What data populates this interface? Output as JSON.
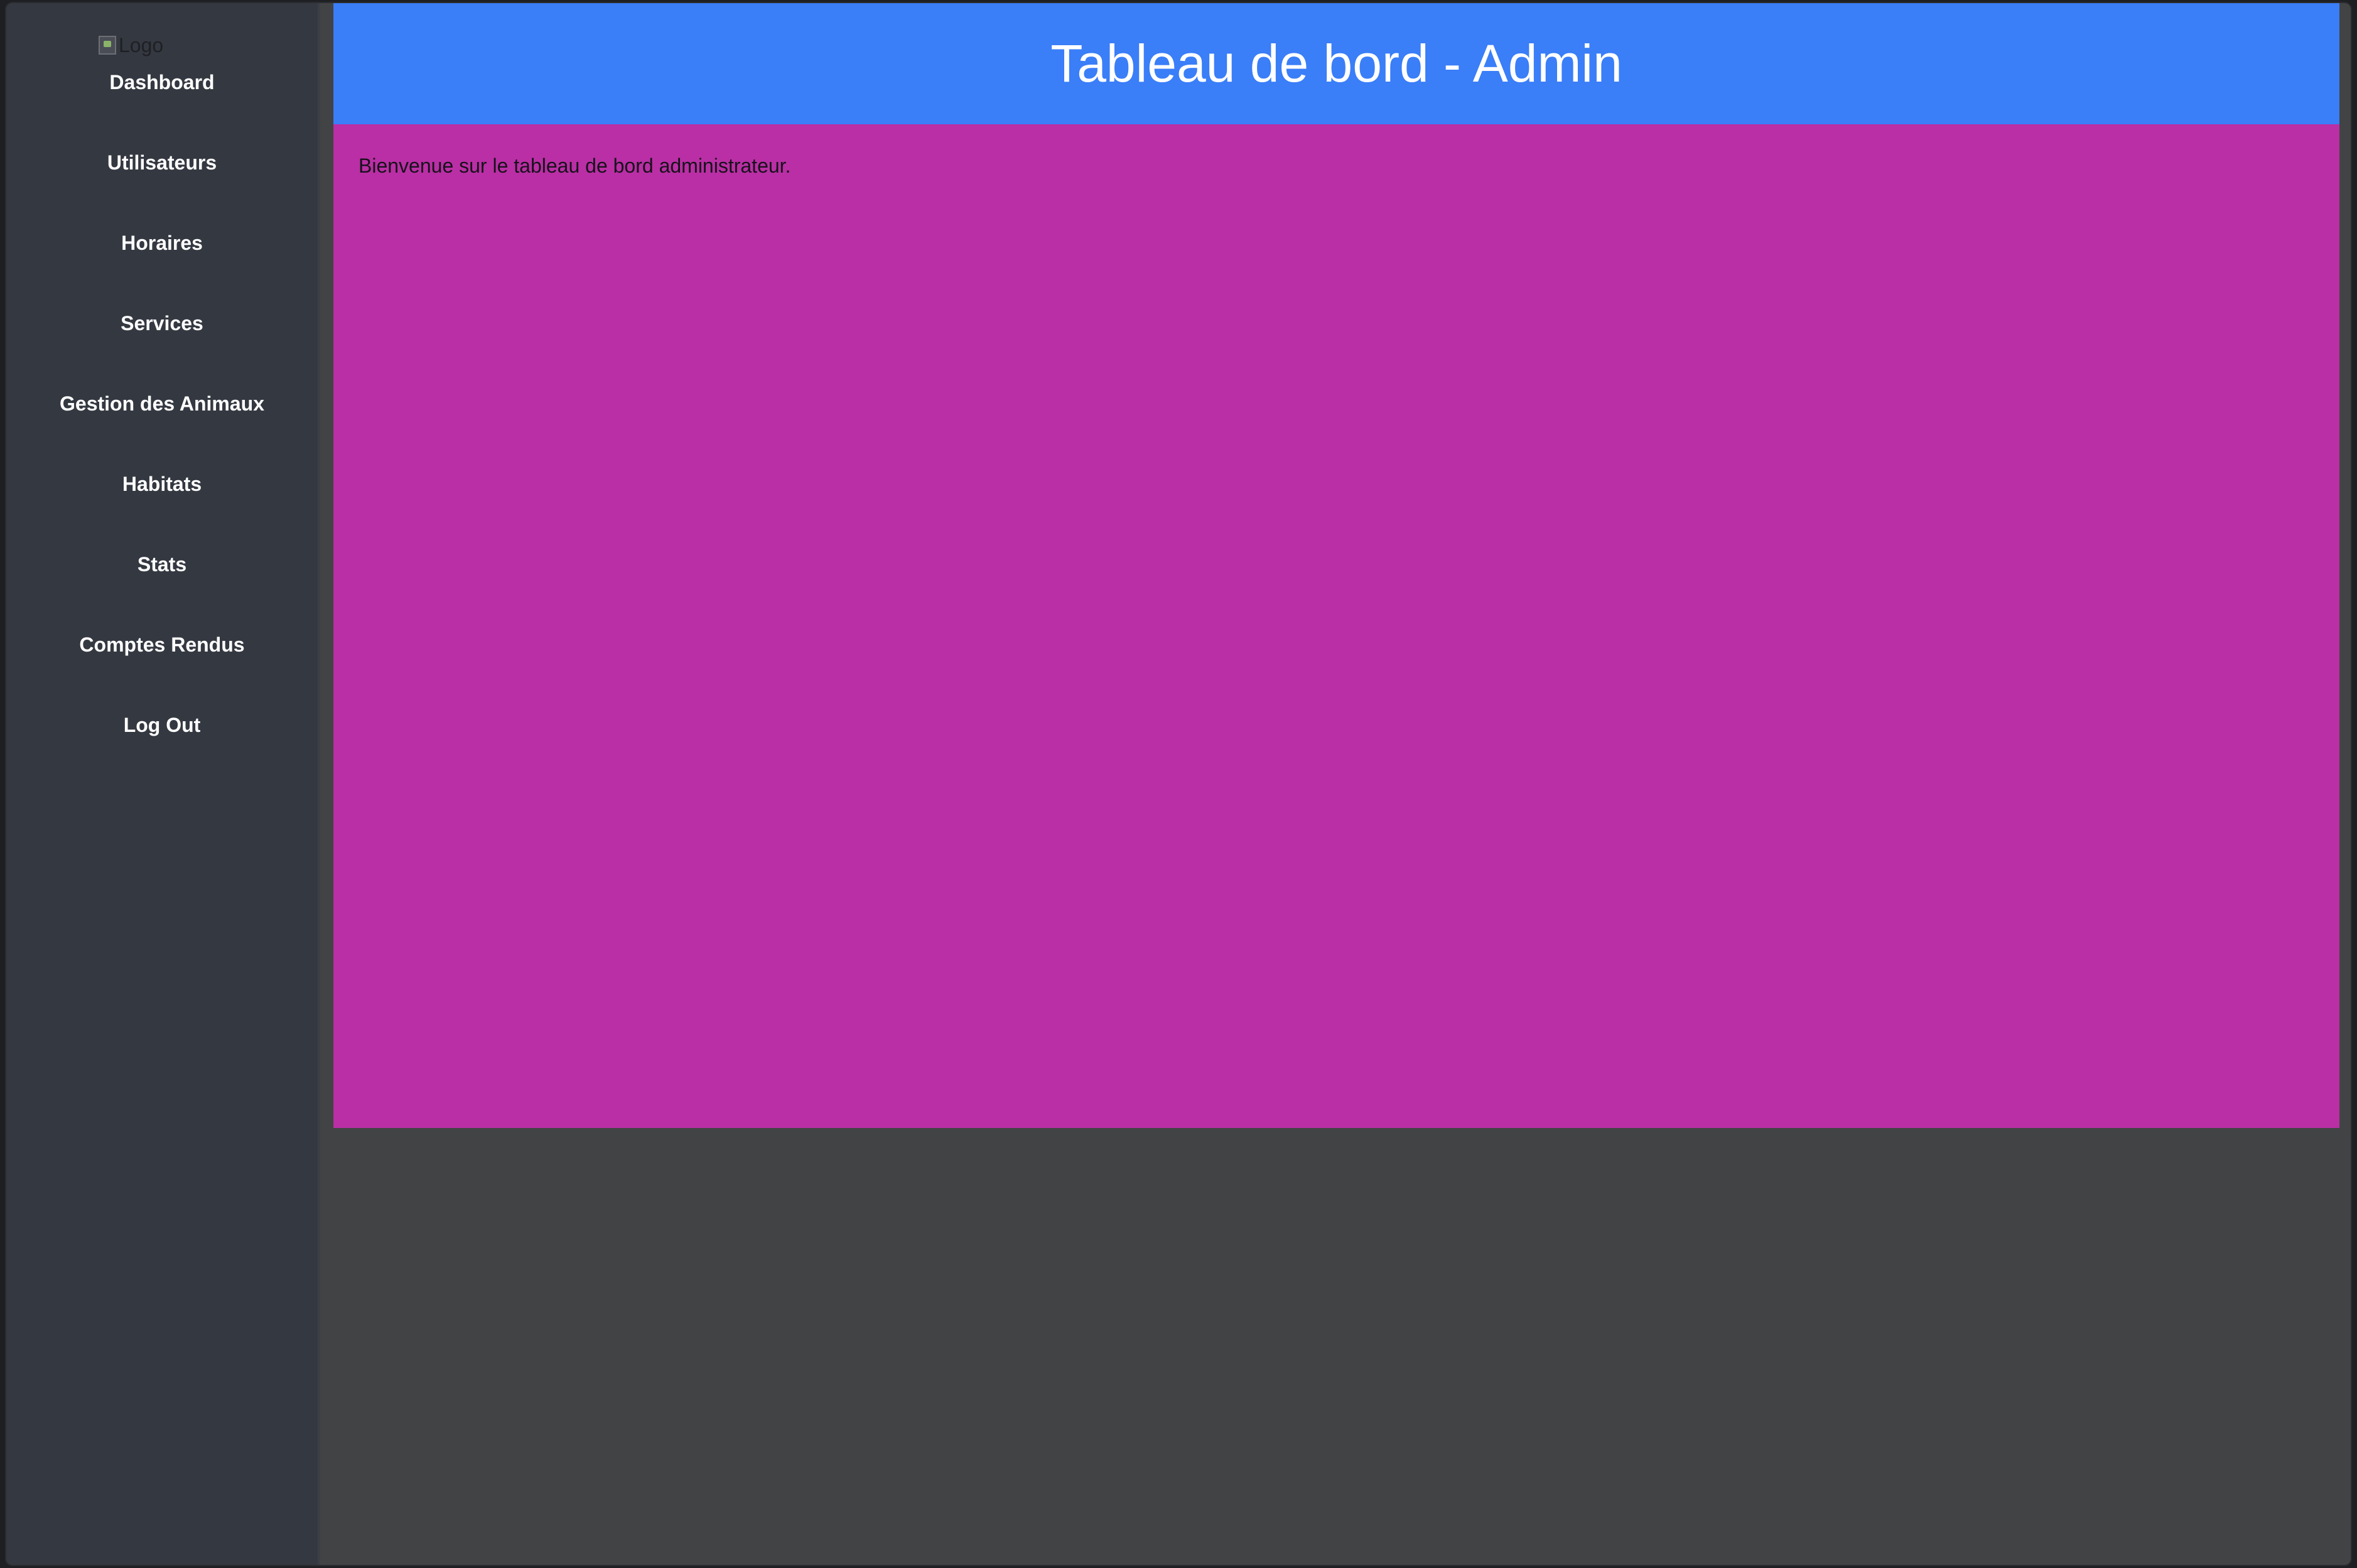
{
  "sidebar": {
    "logo_alt": "Logo",
    "items": [
      {
        "label": "Dashboard"
      },
      {
        "label": "Utilisateurs"
      },
      {
        "label": "Horaires"
      },
      {
        "label": "Services"
      },
      {
        "label": "Gestion des Animaux"
      },
      {
        "label": "Habitats"
      },
      {
        "label": "Stats"
      },
      {
        "label": "Comptes Rendus"
      },
      {
        "label": "Log Out"
      }
    ]
  },
  "header": {
    "title": "Tableau de bord - Admin"
  },
  "main": {
    "welcome_text": "Bienvenue sur le tableau de bord administrateur."
  },
  "colors": {
    "header_bg": "#3a7ef8",
    "content_bg": "#ba2fa5",
    "sidebar_bg": "#343841",
    "page_bg": "#424345"
  }
}
